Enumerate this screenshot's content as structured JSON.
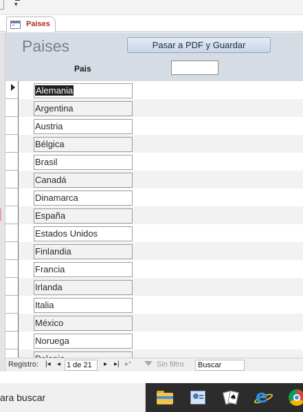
{
  "tab": {
    "label": "Paises"
  },
  "form": {
    "title": "Paises",
    "pdf_button_label": "Pasar a PDF y Guardar",
    "column_label": "Pais",
    "filter_value": ""
  },
  "records": [
    {
      "pais": "Alemania",
      "selected": true
    },
    {
      "pais": "Argentina"
    },
    {
      "pais": "Austria"
    },
    {
      "pais": "Bélgica"
    },
    {
      "pais": "Brasil"
    },
    {
      "pais": "Canadá"
    },
    {
      "pais": "Dinamarca"
    },
    {
      "pais": "España"
    },
    {
      "pais": "Estados Unidos"
    },
    {
      "pais": "Finlandia"
    },
    {
      "pais": "Francia"
    },
    {
      "pais": "Irlanda"
    },
    {
      "pais": "Italia"
    },
    {
      "pais": "México"
    },
    {
      "pais": "Noruega"
    },
    {
      "pais": "Polonia"
    }
  ],
  "nav": {
    "label": "Registro:",
    "current": "1 de 21",
    "filter_label": "Sin filtro",
    "search_label": "Buscar",
    "first_icon": "first-record-icon",
    "prev_icon": "prev-record-icon",
    "next_icon": "next-record-icon",
    "last_icon": "last-record-icon",
    "new_icon": "new-record-icon"
  },
  "taskbar": {
    "search_text": "ara buscar",
    "apps": [
      "file-explorer-icon",
      "contacts-icon",
      "solitaire-icon",
      "internet-explorer-icon",
      "chrome-icon"
    ]
  },
  "colors": {
    "tab_label": "#b22a2a",
    "header_bg": "#d6dce4",
    "taskbar_bg": "#2c2c2c"
  }
}
